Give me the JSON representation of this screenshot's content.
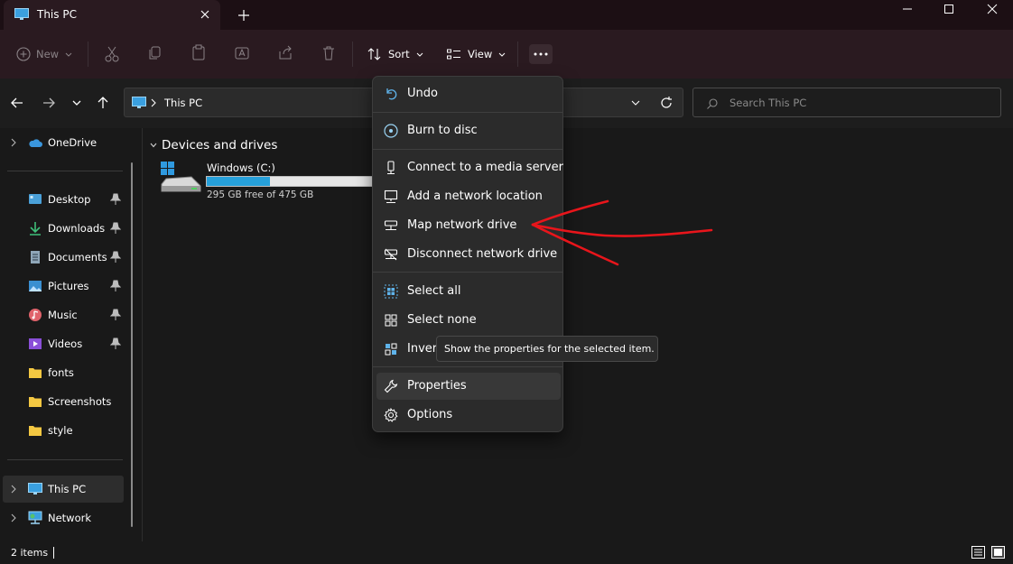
{
  "window": {
    "tab_title": "This PC",
    "new_tab_symbol": "+"
  },
  "toolbar": {
    "new_label": "New",
    "sort_label": "Sort",
    "view_label": "View"
  },
  "address": {
    "path": "This PC",
    "search_placeholder": "Search This PC"
  },
  "sidebar": {
    "onedrive": "OneDrive",
    "pinned": [
      {
        "label": "Desktop",
        "icon": "desktop-icon"
      },
      {
        "label": "Downloads",
        "icon": "downloads-icon"
      },
      {
        "label": "Documents",
        "icon": "documents-icon"
      },
      {
        "label": "Pictures",
        "icon": "pictures-icon"
      },
      {
        "label": "Music",
        "icon": "music-icon"
      },
      {
        "label": "Videos",
        "icon": "videos-icon"
      }
    ],
    "folders": [
      {
        "label": "fonts"
      },
      {
        "label": "Screenshots"
      },
      {
        "label": "style"
      }
    ],
    "this_pc": "This PC",
    "network": "Network"
  },
  "content": {
    "group_title": "Devices and drives",
    "drive": {
      "name": "Windows  (C:)",
      "free_text": "295 GB free of 475 GB",
      "used_fraction": 0.379
    }
  },
  "menu": {
    "items": [
      {
        "label": "Undo",
        "icon": "undo-icon"
      },
      {
        "label": "Burn to disc",
        "icon": "disc-icon"
      },
      {
        "label": "Connect to a media server",
        "icon": "media-server-icon"
      },
      {
        "label": "Add a network location",
        "icon": "network-location-icon"
      },
      {
        "label": "Map network drive",
        "icon": "map-drive-icon"
      },
      {
        "label": "Disconnect network drive",
        "icon": "disconnect-drive-icon"
      },
      {
        "label": "Select all",
        "icon": "select-all-icon"
      },
      {
        "label": "Select none",
        "icon": "select-none-icon"
      },
      {
        "label": "Invert selection",
        "icon": "invert-selection-icon"
      },
      {
        "label": "Properties",
        "icon": "wrench-icon"
      },
      {
        "label": "Options",
        "icon": "gear-icon"
      }
    ],
    "tooltip": "Show the properties for the selected item."
  },
  "status": {
    "items_count": "2 items"
  },
  "colors": {
    "accent": "#26a0da",
    "folder": "#f4c842",
    "annotation": "#e8151b"
  }
}
